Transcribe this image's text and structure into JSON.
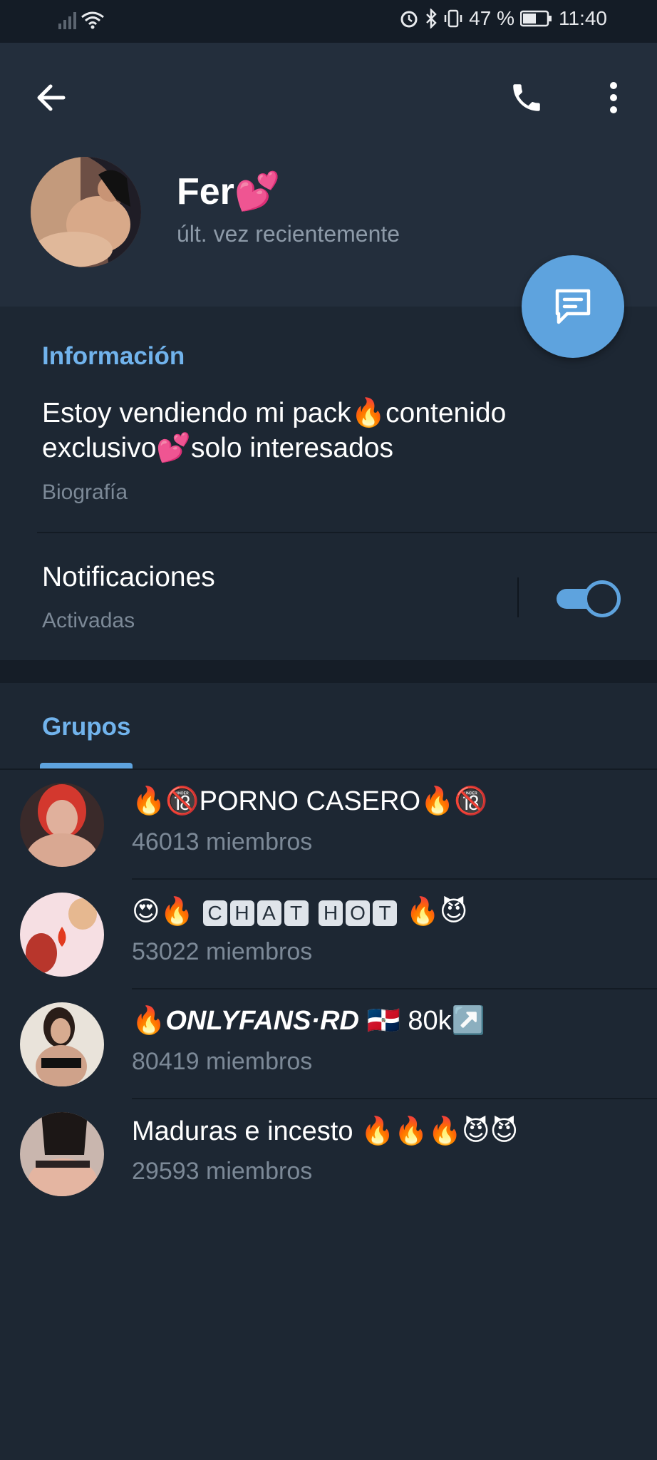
{
  "status_bar": {
    "battery_text": "47 %",
    "time": "11:40"
  },
  "header": {
    "name": "Fer💕",
    "last_seen": "últ. vez recientemente"
  },
  "info": {
    "section_title": "Información",
    "bio": "Estoy vendiendo mi pack🔥contenido exclusivo💕solo interesados",
    "bio_label": "Biografía",
    "notifications_title": "Notificaciones",
    "notifications_status": "Activadas",
    "notifications_enabled": true
  },
  "groups": {
    "tab_label": "Grupos",
    "items": [
      {
        "title": "🔥🔞PORNO CASERO🔥🔞",
        "members": "46013 miembros"
      },
      {
        "title_prefix": "😍🔥 ",
        "title_keys_1": [
          "C",
          "H",
          "A",
          "T"
        ],
        "title_keys_2": [
          "H",
          "O",
          "T"
        ],
        "title_suffix": " 🔥😈",
        "members": "53022 miembros"
      },
      {
        "title_prefix": "🔥",
        "title_bold": "ONLYFANS·RD",
        "title_suffix": " 🇩🇴 80k↗️",
        "members": "80419 miembros"
      },
      {
        "title": "Maduras e incesto 🔥🔥🔥😈😈",
        "members": "29593 miembros"
      }
    ]
  },
  "colors": {
    "accent": "#5ea3de",
    "section_title": "#71b3ec",
    "background": "#1d2733",
    "header_bg": "#232e3c"
  }
}
